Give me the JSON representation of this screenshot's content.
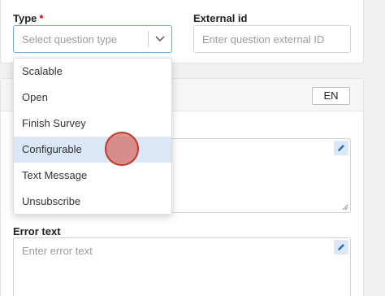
{
  "type_field": {
    "label": "Type",
    "required_mark": "*",
    "placeholder": "Select question type"
  },
  "external_id_field": {
    "label": "External id",
    "placeholder": "Enter question external ID"
  },
  "language_button": "EN",
  "error_text_field": {
    "label": "Error text",
    "placeholder": "Enter error text"
  },
  "dropdown_options": [
    {
      "label": "Scalable",
      "selected": false
    },
    {
      "label": "Open",
      "selected": false
    },
    {
      "label": "Finish Survey",
      "selected": false
    },
    {
      "label": "Configurable",
      "selected": true
    },
    {
      "label": "Text Message",
      "selected": false
    },
    {
      "label": "Unsubscribe",
      "selected": false
    }
  ],
  "colors": {
    "focus_border": "#6fa8dc",
    "selected_option_bg": "#dbe6f6",
    "required_asterisk": "#d0021b",
    "cursor_indicator": "#d66660"
  },
  "icons": [
    "chevron-down-icon",
    "pencil-icon",
    "resize-grip-icon"
  ]
}
